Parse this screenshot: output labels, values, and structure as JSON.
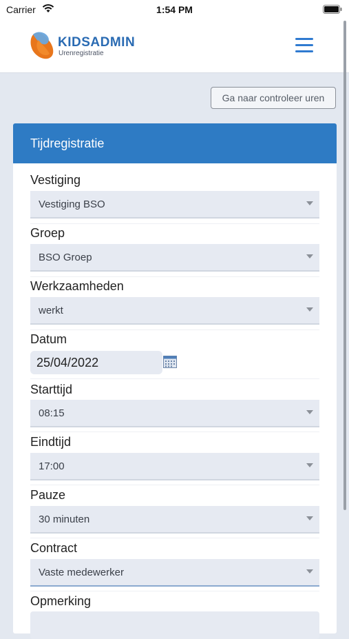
{
  "status_bar": {
    "carrier": "Carrier",
    "time": "1:54 PM"
  },
  "header": {
    "brand_name": "KIDSADMIN",
    "brand_sub": "Urenregistratie",
    "menu_icon": "hamburger-menu-icon"
  },
  "toolbar": {
    "check_button_label": "Ga naar controleer uren"
  },
  "form": {
    "title": "Tijdregistratie",
    "fields": [
      {
        "label": "Vestiging",
        "value": "Vestiging BSO"
      },
      {
        "label": "Groep",
        "value": "BSO Groep"
      },
      {
        "label": "Werkzaamheden",
        "value": "werkt"
      },
      {
        "label": "Datum",
        "value": "25/04/2022"
      },
      {
        "label": "Starttijd",
        "value": "08:15"
      },
      {
        "label": "Eindtijd",
        "value": "17:00"
      },
      {
        "label": "Pauze",
        "value": "30 minuten"
      },
      {
        "label": "Contract",
        "value": "Vaste medewerker"
      },
      {
        "label": "Opmerking",
        "value": ""
      }
    ]
  },
  "colors": {
    "accent": "#2e7bc4",
    "brand": "#2a6bb3",
    "background": "#e3e8f0",
    "field": "#e6eaf2"
  }
}
